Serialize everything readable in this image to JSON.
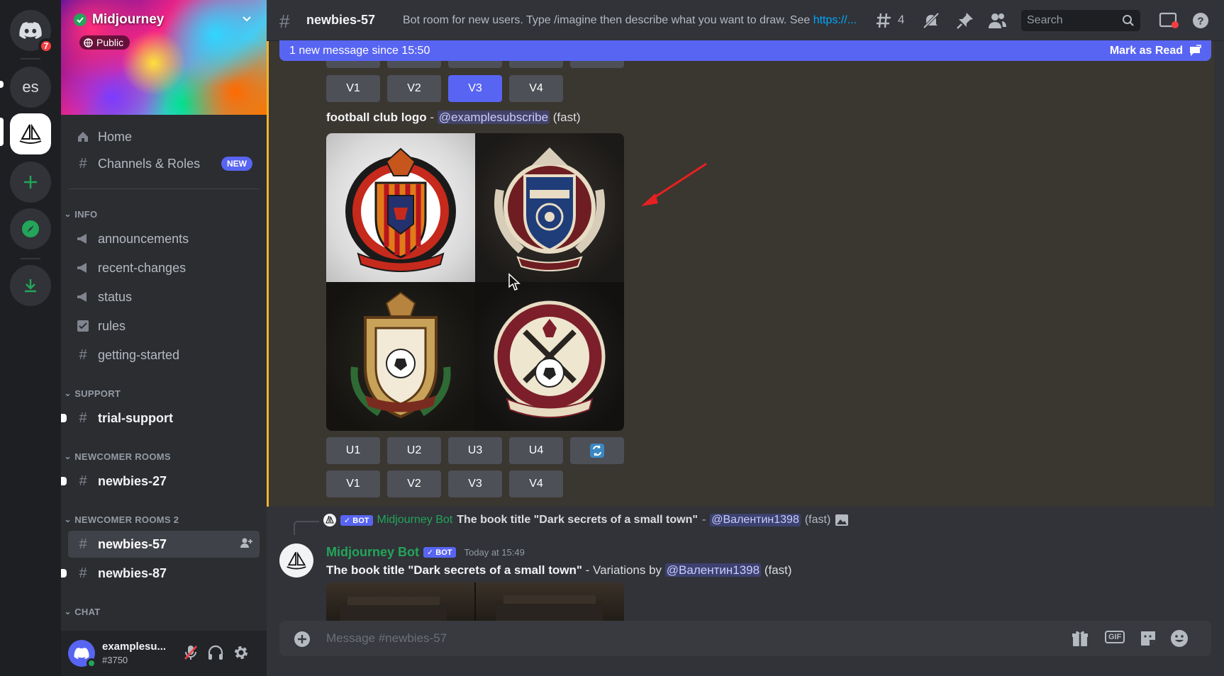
{
  "rail": {
    "dm_badge": "7",
    "server_es": "es"
  },
  "server": {
    "name": "Midjourney",
    "public_label": "Public"
  },
  "sidebar": {
    "home": "Home",
    "channels_roles": "Channels & Roles",
    "new_badge": "NEW",
    "categories": {
      "info": "INFO",
      "support": "SUPPORT",
      "newcomer": "NEWCOMER ROOMS",
      "newcomer2": "NEWCOMER ROOMS 2",
      "chat": "CHAT"
    },
    "channels": {
      "announcements": "announcements",
      "recent_changes": "recent-changes",
      "status": "status",
      "rules": "rules",
      "getting_started": "getting-started",
      "trial_support": "trial-support",
      "newbies27": "newbies-27",
      "newbies57": "newbies-57",
      "newbies87": "newbies-87"
    }
  },
  "user": {
    "name": "examplesu...",
    "tag": "#3750"
  },
  "header": {
    "channel": "newbies-57",
    "topic": "Bot room for new users. Type /imagine then describe what you want to draw. See ",
    "topic_link": "https://...",
    "threads_count": "4",
    "search_placeholder": "Search"
  },
  "newbar": {
    "text": "1 new message since 15:50",
    "mark": "Mark as Read"
  },
  "msg1": {
    "top_buttons": [
      "V1",
      "V2",
      "V3",
      "V4"
    ],
    "prompt": "football club logo",
    "sep": " - ",
    "mention": "@examplesubscribe",
    "speed": " (fast)",
    "upscale_buttons": [
      "U1",
      "U2",
      "U3",
      "U4"
    ],
    "variation_buttons": [
      "V1",
      "V2",
      "V3",
      "V4"
    ]
  },
  "msg2": {
    "reply_bot": "BOT",
    "reply_author": "Midjourney Bot",
    "reply_prompt": "The book title \"Dark secrets of a small town\"",
    "reply_sep": " - ",
    "reply_mention": "@Валентин1398",
    "reply_speed": "(fast)",
    "author": "Midjourney Bot",
    "bot": "BOT",
    "time": "Today at 15:49",
    "prompt": "The book title \"Dark secrets of a small town\"",
    "suffix": " - Variations by ",
    "mention": "@Валентин1398",
    "speed": " (fast)"
  },
  "composer": {
    "placeholder": "Message #newbies-57",
    "gif": "GIF"
  }
}
